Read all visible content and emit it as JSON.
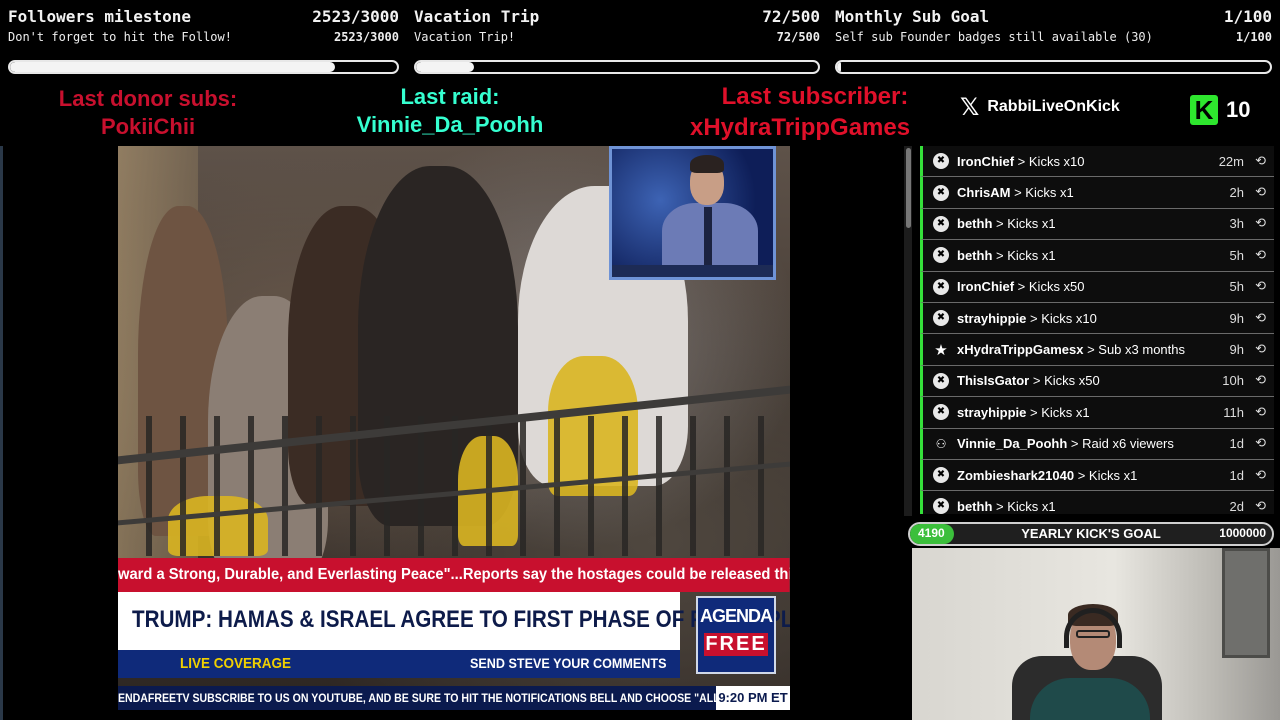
{
  "goals": [
    {
      "title": "Followers milestone",
      "count": "2523/3000",
      "subtitle": "Don't forget to hit the Follow!",
      "subcount": "2523/3000",
      "progress": 0.841
    },
    {
      "title": "Vacation Trip",
      "count": "72/500",
      "subtitle": "Vacation Trip!",
      "subcount": "72/500",
      "progress": 0.144
    },
    {
      "title": "Monthly Sub Goal",
      "count": "1/100",
      "subtitle": "Self sub Founder badges still available (30)",
      "subcount": "1/100",
      "progress": 0.01
    }
  ],
  "last_info": {
    "donor_label": "Last donor subs:",
    "donor_name": "PokiiChii",
    "raid_label": "Last raid:",
    "raid_name": "Vinnie_Da_Poohh",
    "subscriber_label": "Last subscriber:",
    "subscriber_name": "xHydraTrippGames"
  },
  "social": {
    "x_handle": "RabbiLiveOnKick",
    "kick_icon": "K",
    "kick_count": "10"
  },
  "colors": {
    "accent_green": "#35e03a",
    "red": "#c8102e",
    "raid_cyan": "#35ffd0"
  },
  "video": {
    "ticker": "ward a Strong, Durable, and Everlasting Peace\"...Reports say the hostages could be released this weekend or Mon",
    "headline": "TRUMP: HAMAS & ISRAEL AGREE TO FIRST PHASE OF PEACE PLAN",
    "live": "LIVE COVERAGE",
    "send": "SEND STEVE YOUR COMMENTS",
    "logo_top": "AGENDA",
    "logo_bottom": "FREE",
    "crawl": "ENDAFREETV    SUBSCRIBE TO US ON YOUTUBE, AND BE SURE TO HIT THE NOTIFICATIONS BELL AND CHOOSE \"ALL NOTIFICATIO",
    "time": "9:20 PM ET"
  },
  "events": [
    {
      "user": "IronChief",
      "action": "Kicks x10",
      "time": "22m",
      "icon": "kick-icon"
    },
    {
      "user": "ChrisAM",
      "action": "Kicks x1",
      "time": "2h",
      "icon": "kick-icon"
    },
    {
      "user": "bethh",
      "action": "Kicks x1",
      "time": "3h",
      "icon": "kick-icon"
    },
    {
      "user": "bethh",
      "action": "Kicks x1",
      "time": "5h",
      "icon": "kick-icon"
    },
    {
      "user": "IronChief",
      "action": "Kicks x50",
      "time": "5h",
      "icon": "kick-icon"
    },
    {
      "user": "strayhippie",
      "action": "Kicks x10",
      "time": "9h",
      "icon": "kick-icon"
    },
    {
      "user": "xHydraTrippGamesx",
      "action": "Sub x3 months",
      "time": "9h",
      "icon": "star-icon"
    },
    {
      "user": "ThisIsGator",
      "action": "Kicks x50",
      "time": "10h",
      "icon": "kick-icon"
    },
    {
      "user": "strayhippie",
      "action": "Kicks x1",
      "time": "11h",
      "icon": "kick-icon"
    },
    {
      "user": "Vinnie_Da_Poohh",
      "action": "Raid x6 viewers",
      "time": "1d",
      "icon": "raid-icon"
    },
    {
      "user": "Zombieshark21040",
      "action": "Kicks x1",
      "time": "1d",
      "icon": "kick-icon"
    },
    {
      "user": "bethh",
      "action": "Kicks x1",
      "time": "2d",
      "icon": "kick-icon"
    }
  ],
  "yearly_goal": {
    "current": "4190",
    "label": "YEARLY KICK'S GOAL",
    "target": "1000000",
    "progress": 0.0042
  }
}
